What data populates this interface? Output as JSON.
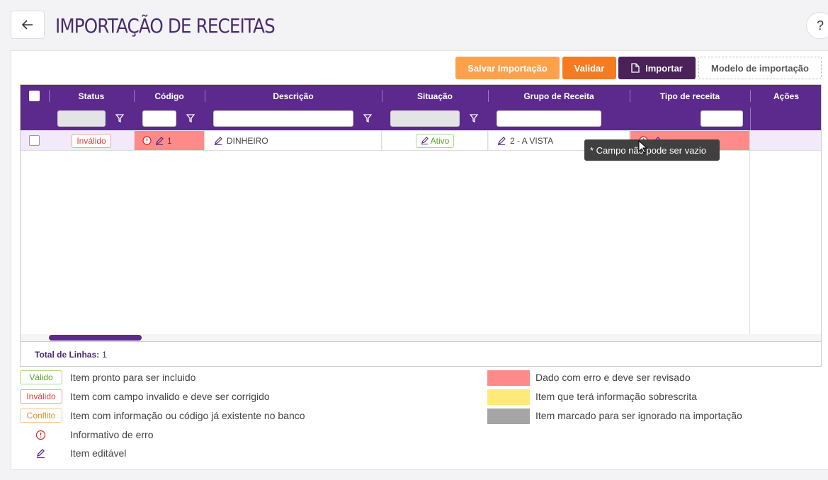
{
  "header": {
    "title": "IMPORTAÇÃO DE RECEITAS",
    "back_icon": "arrow-left-icon",
    "help_label": "?"
  },
  "toolbar": {
    "save_label": "Salvar Importação",
    "validate_label": "Validar",
    "import_label": "Importar",
    "model_label": "Modelo de importação",
    "colors": {
      "save": "#ffa04a",
      "validate": "#f47b20",
      "import": "#4a2158"
    }
  },
  "grid": {
    "header_color": "#5b2a8c",
    "columns": [
      "Status",
      "Código",
      "Descrição",
      "Situação",
      "Grupo de Receita",
      "Tipo de receita",
      "Ações"
    ],
    "rows": [
      {
        "status": "Inválido",
        "codigo": "1",
        "descricao": "DINHEIRO",
        "situacao": "Ativo",
        "grupo": "2 - A VISTA",
        "tipo": ""
      }
    ],
    "tooltip": "* Campo não pode ser vazio",
    "footer_label": "Total de Linhas:",
    "footer_count": "1"
  },
  "legend": {
    "valid_badge": "Válido",
    "valid_text": "Item pronto para ser incluido",
    "invalid_badge": "Inválido",
    "invalid_text": "Item com campo invalido e deve ser corrigido",
    "conflict_badge": "Conflito",
    "conflict_text": "Item com informação ou código já existente no banco",
    "error_info_text": "Informativo de erro",
    "editable_text": "Item editável",
    "error_swatch_text": "Dado com erro e deve ser revisado",
    "overwrite_swatch_text": "Item que terá informação sobrescrita",
    "ignored_swatch_text": "Item marcado para ser ignorado na importação",
    "colors": {
      "error": "#ff8a8a",
      "overwrite": "#ffe97a",
      "ignored": "#a5a5a5"
    }
  }
}
